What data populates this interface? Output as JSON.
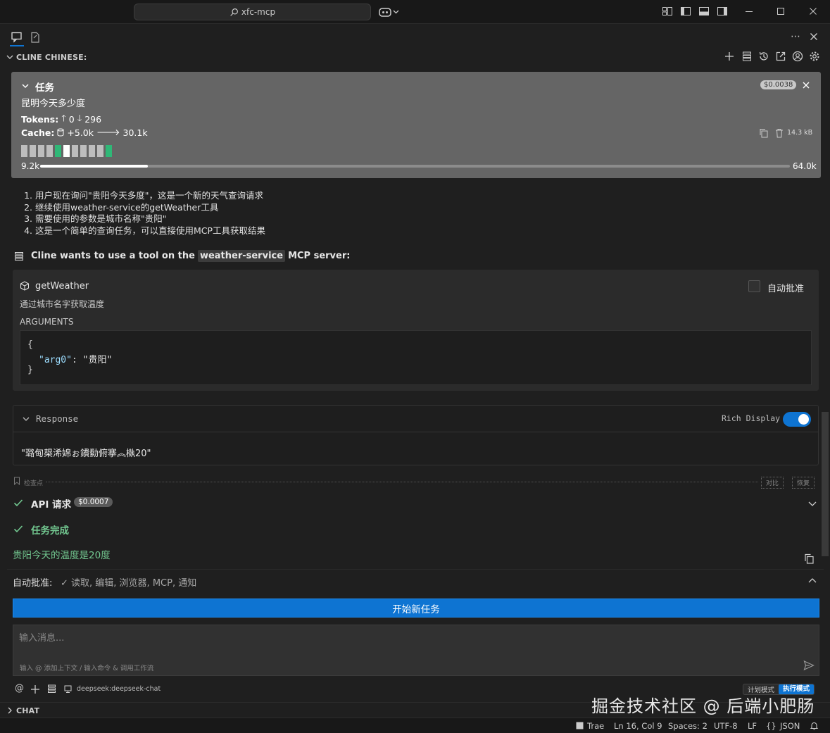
{
  "titlebar": {
    "search_text": "xfc-mcp"
  },
  "panel": {
    "header_title": "CLINE CHINESE:"
  },
  "task": {
    "label": "任务",
    "cost": "$0.0038",
    "prompt": "昆明今天多少度",
    "tokens_label": "Tokens:",
    "tokens_up": "0",
    "tokens_down": "296",
    "cache_label": "Cache:",
    "cache_write": "+5.0k",
    "cache_read": "30.1k",
    "size": "14.3 kB",
    "context_used": "9.2k",
    "context_max": "64.0k",
    "context_fraction": 0.144,
    "colors": {
      "seg": "#bdbdbd",
      "seg_green": "#2fb877",
      "seg_white": "#ffffff"
    }
  },
  "steps": [
    "用户现在询问\"贵阳今天多度\"，这是一个新的天气查询请求",
    "继续使用weather-service的getWeather工具",
    "需要使用的参数是城市名称\"贵阳\"",
    "这是一个简单的查询任务，可以直接使用MCP工具获取结果"
  ],
  "tool_request": {
    "prefix": "Cline wants to use a tool on the",
    "server": "weather-service",
    "suffix": "MCP server:",
    "tool_name": "getWeather",
    "tool_desc": "通过城市名字获取温度",
    "auto_approve": "自动批准",
    "arguments_label": "ARGUMENTS",
    "args_open": "{",
    "arg_key": "\"arg0\"",
    "arg_sep": ": ",
    "arg_value": "\"贵阳\"",
    "args_close": "}"
  },
  "response": {
    "label": "Response",
    "rich_display": "Rich Display",
    "rich_display_on": true,
    "text": "\"璐甸槼浠婂ぉ鐨勬俯搴︽槸20\""
  },
  "checkpoint": {
    "label": "检查点",
    "compare": "对比",
    "restore": "恢复"
  },
  "api_request": {
    "label": "API 请求",
    "cost": "$0.0007"
  },
  "task_complete": {
    "label": "任务完成",
    "result": "贵阳今天的温度是20度"
  },
  "auto_approve_bar": {
    "label": "自动批准:",
    "items": "✓ 读取, 编辑, 浏览器, MCP, 通知"
  },
  "new_task_button": "开始新任务",
  "input": {
    "placeholder": "输入消息...",
    "hint": "输入 @ 添加上下文 / 输入命令 & 调用工作流"
  },
  "model": "deepseek:deepseek-chat",
  "modes": {
    "plan": "计划模式",
    "act": "执行模式"
  },
  "chat_section": "CHAT",
  "watermark": "掘金技术社区 @ 后端小肥肠",
  "statusbar": {
    "app": "Trae",
    "position": "Ln 16, Col 9",
    "spaces": "Spaces: 2",
    "encoding": "UTF-8",
    "eol": "LF",
    "language": "JSON"
  }
}
